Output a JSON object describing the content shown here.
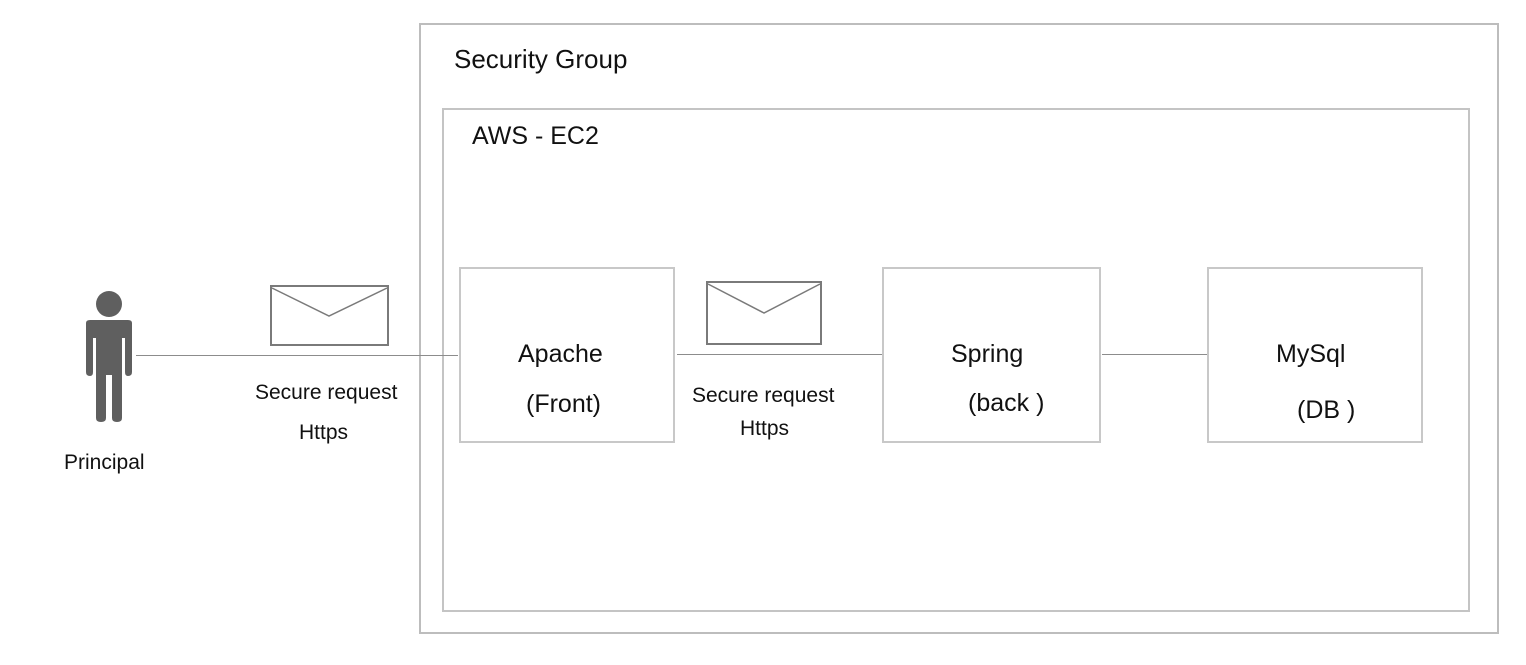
{
  "security_group": {
    "label": "Security Group"
  },
  "ec2": {
    "label": "AWS - EC2"
  },
  "principal": {
    "label": "Principal",
    "icon": "person-icon"
  },
  "request_1": {
    "label": "Secure request",
    "protocol": "Https",
    "icon": "envelope-icon"
  },
  "request_2": {
    "label": "Secure request",
    "protocol": "Https",
    "icon": "envelope-icon"
  },
  "nodes": {
    "apache": {
      "name": "Apache",
      "role": "(Front)"
    },
    "spring": {
      "name": "Spring",
      "role": "(back )"
    },
    "mysql": {
      "name": "MySql",
      "role": "(DB )"
    }
  },
  "colors": {
    "box_border": "#c8c8c8",
    "connector": "#8c8c8c",
    "icon_fill": "#5f5f5f",
    "envelope_stroke": "#7a7a7a"
  }
}
